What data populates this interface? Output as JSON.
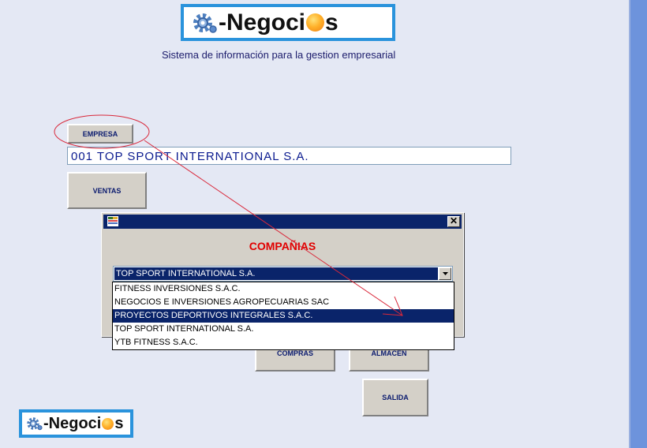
{
  "logo": {
    "prefix": "-Negoci",
    "suffix": "s",
    "mark": "gear-icon"
  },
  "subtitle": "Sistema de información para la gestion empresarial",
  "buttons": {
    "empresa": "EMPRESA",
    "ventas": "VENTAS",
    "compras": "COMPRAS",
    "almacen": "ALMACEN",
    "salida": "SALIDA"
  },
  "company_field": {
    "value": "001 TOP SPORT INTERNATIONAL S.A."
  },
  "dialog": {
    "title": "COMPAÑIAS",
    "close": "✕",
    "combo_value": "TOP SPORT INTERNATIONAL S.A.",
    "options": [
      "FITNESS INVERSIONES S.A.C.",
      "NEGOCIOS E INVERSIONES AGROPECUARIAS SAC",
      "PROYECTOS DEPORTIVOS INTEGRALES S.A.C.",
      "TOP SPORT INTERNATIONAL S.A.",
      "YTB FITNESS S.A.C."
    ],
    "selected_option": "PROYECTOS DEPORTIVOS INTEGRALES S.A.C."
  },
  "colors": {
    "accent": "#2a93dc",
    "annotation": "#d9283a",
    "selection": "#0a246a",
    "title": "#e10000"
  }
}
